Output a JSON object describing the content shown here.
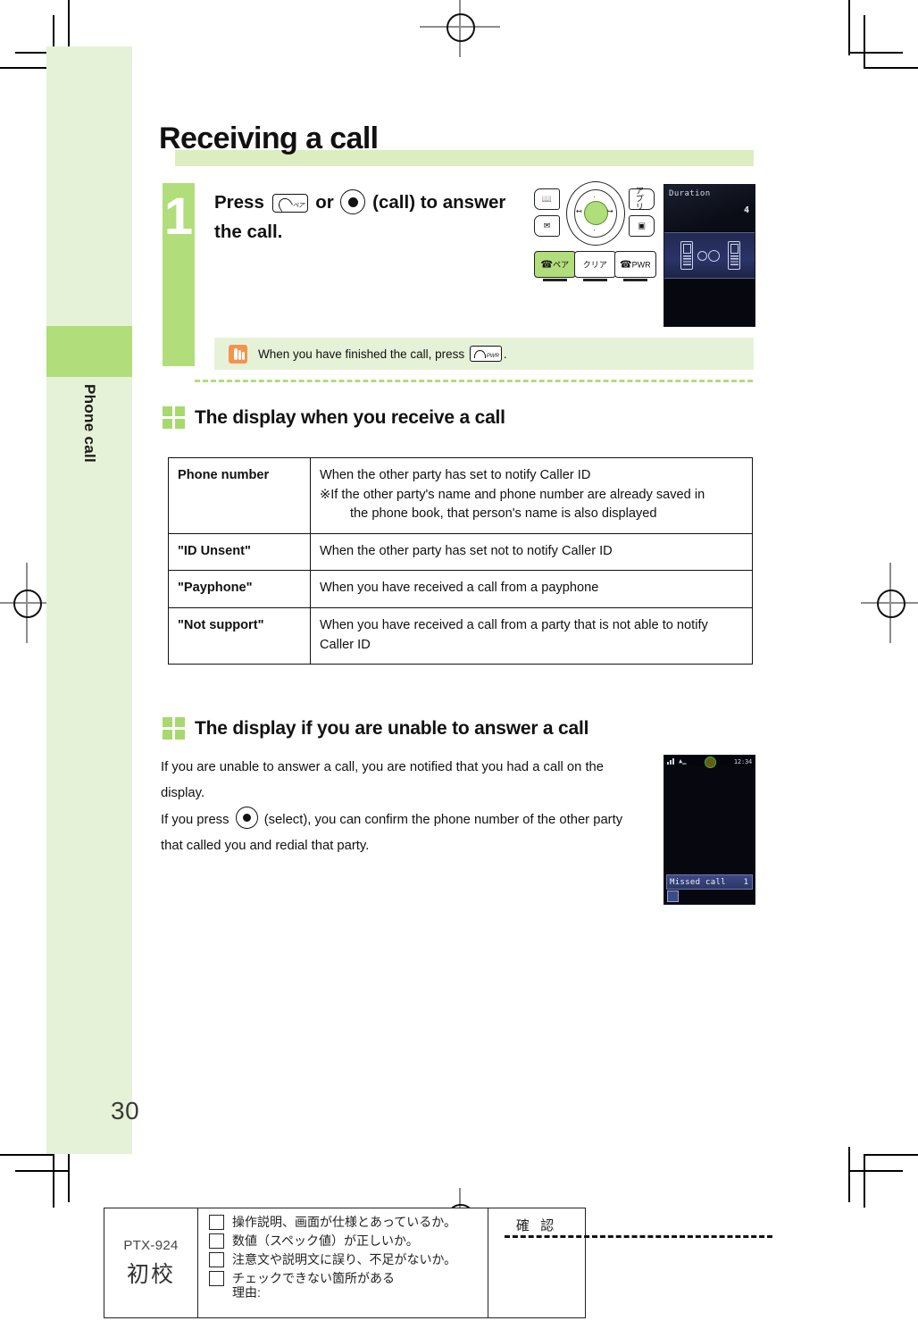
{
  "page": {
    "title": "Receiving a call",
    "number": "30",
    "tab_label": "Phone call"
  },
  "step": {
    "number": "1",
    "text_before_key": "Press",
    "key_send": {
      "kana": "ペア",
      "icon": "handset-icon"
    },
    "text_or": "or",
    "key_select": {
      "icon": "select-dot-icon"
    },
    "text_after": "(call) to answer the call."
  },
  "note": {
    "icon": "pointing-hand-icon",
    "text_before_key": "When you have finished the call, press",
    "key_power": {
      "label": "PWR",
      "icon": "handset-down-icon"
    },
    "text_after": "."
  },
  "keypad": {
    "top_left_key": "book-icon",
    "bottom_left_key": "mail-icon",
    "top_right_key": "アプリ",
    "bottom_right_key": "camera-icon",
    "center_key": "center-select-key",
    "buttons": [
      {
        "name": "send-key",
        "label": "ペア"
      },
      {
        "name": "clear-key",
        "label": "クリア"
      },
      {
        "name": "power-key",
        "label": "PWR"
      }
    ]
  },
  "screen_duration": {
    "label": "Duration",
    "value": "4"
  },
  "screen_missed": {
    "time": "12:34",
    "message": "Missed call",
    "count": "1"
  },
  "sections": [
    {
      "heading": "The display when you receive a call"
    },
    {
      "heading": "The display if you are unable to answer a call"
    }
  ],
  "table": {
    "rows": [
      {
        "label": "Phone number",
        "desc_line1": "When the other party has set to notify Caller ID",
        "desc_line2": "※If the other party's name and phone number are already saved in",
        "desc_line3": "the phone book, that person's name is also displayed"
      },
      {
        "label": "\"ID Unsent\"",
        "desc_line1": "When the other party has set not to notify Caller ID",
        "desc_line2": "",
        "desc_line3": ""
      },
      {
        "label": "\"Payphone\"",
        "desc_line1": "When you have received a call from a payphone",
        "desc_line2": "",
        "desc_line3": ""
      },
      {
        "label": "\"Not support\"",
        "desc_line1": "When you have received a call from a party that is not able to notify Caller ID",
        "desc_line2": "",
        "desc_line3": ""
      }
    ]
  },
  "paragraph": {
    "line1": "If you are unable to answer a call, you are notified that you had a call on the display.",
    "line2_before": "If you press",
    "line2_after": "(select), you can confirm the phone number of the other party that called you and redial that party."
  },
  "proof": {
    "code": "PTX-924",
    "stage": "初校",
    "confirm": "確 認",
    "items": [
      "操作説明、画面が仕様とあっているか。",
      "数値（スペック値）が正しいか。",
      "注意文や説明文に誤り、不足がないか。",
      "チェックできない箇所がある",
      "理由:"
    ]
  },
  "colors": {
    "accent_green": "#b1dd7a",
    "pale_green": "#e6f2d7",
    "band_green": "#dcedc0",
    "marker_green": "#a7d96f",
    "note_orange": "#f4944c"
  }
}
